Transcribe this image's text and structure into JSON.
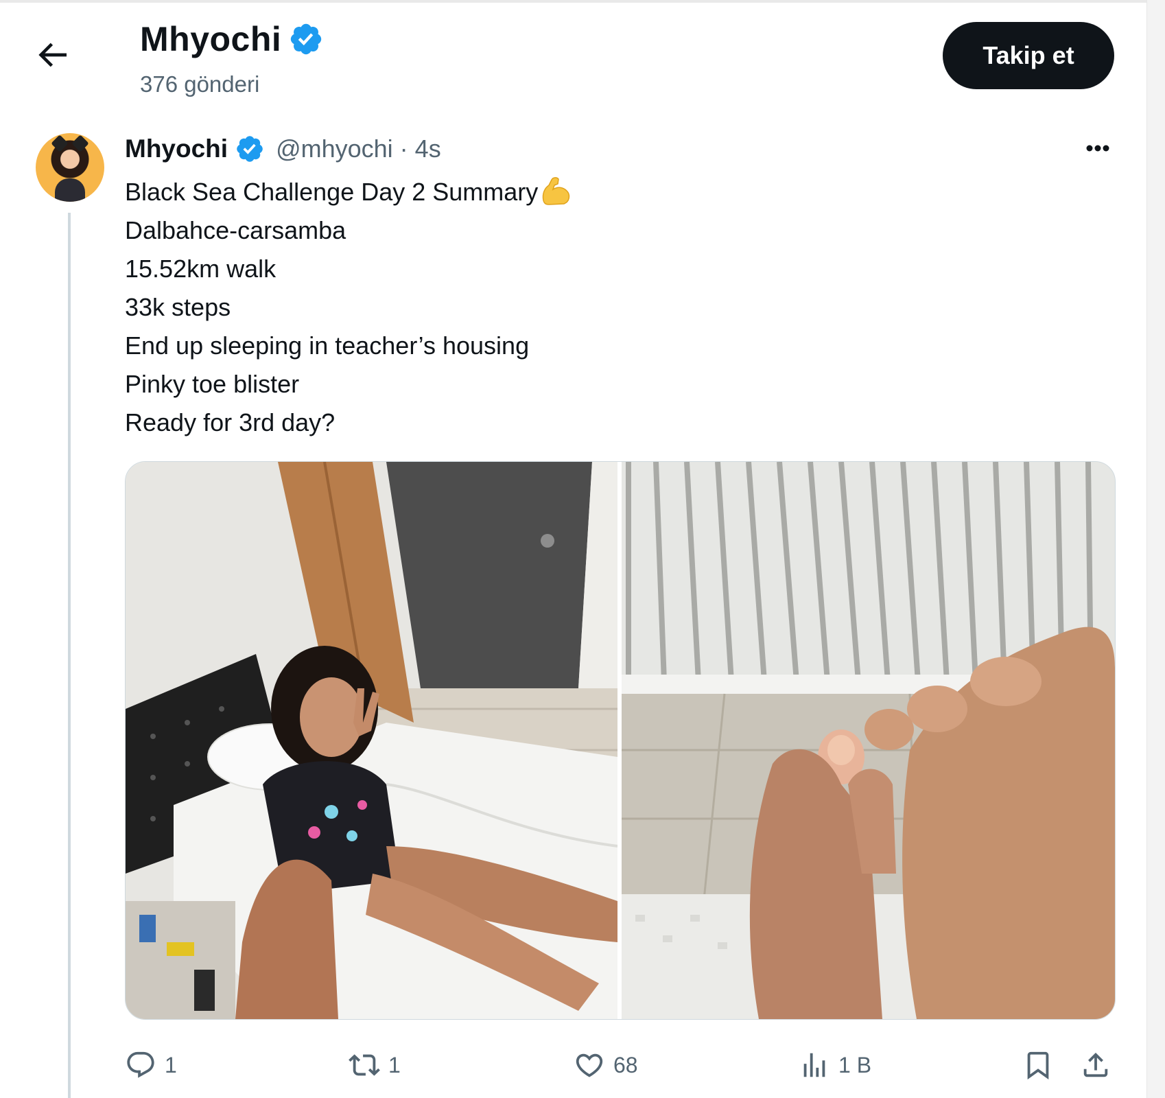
{
  "header": {
    "title": "Mhyochi",
    "post_count": "376 gönderi",
    "follow_label": "Takip et"
  },
  "tweet": {
    "name": "Mhyochi",
    "handle": "@mhyochi",
    "separator": "·",
    "time": "4s",
    "lines": [
      "Black Sea Challenge Day 2 Summary",
      "Dalbahce-carsamba",
      "15.52km walk",
      "33k steps",
      "End up sleeping in teacher’s housing",
      "Pinky toe blister",
      "Ready for 3rd day?"
    ],
    "title_emoji": "flexed-biceps-icon",
    "media": [
      {
        "name": "bedroom-selfie-photo"
      },
      {
        "name": "foot-blister-photo"
      }
    ]
  },
  "actions": {
    "reply_count": "1",
    "retweet_count": "1",
    "like_count": "68",
    "views_count": "1 B"
  },
  "colors": {
    "text": "#0f1419",
    "secondary": "#536471",
    "verified": "#1d9bf0",
    "follow_bg": "#0f1419",
    "thread_line": "#cfd9de"
  }
}
